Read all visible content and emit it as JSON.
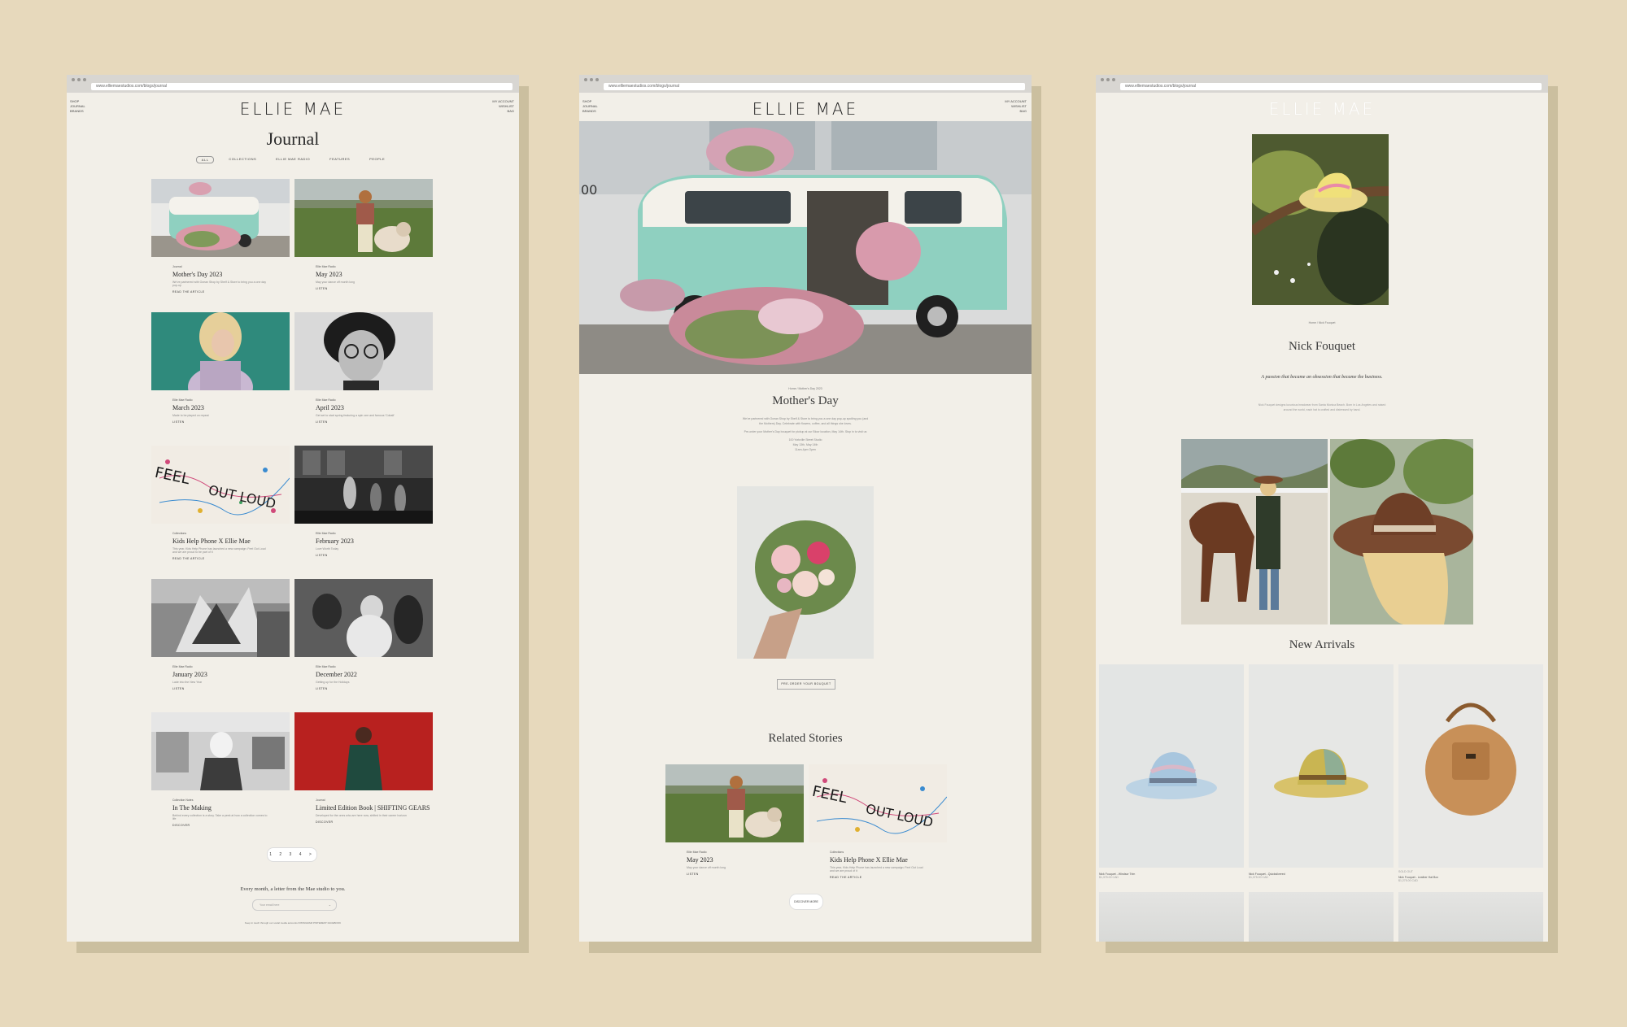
{
  "brand": "ELLIE MAE",
  "url": "www.elliemaestudios.com/blogs/journal",
  "nav_left": [
    "SHOP",
    "JOURNAL",
    "BRANDS"
  ],
  "nav_right": [
    "MY ACCOUNT",
    "WISHLIST",
    "BAG"
  ],
  "journal": {
    "title": "Journal",
    "filters": [
      "ALL",
      "COLLECTIONS",
      "ELLIE MAE RADIO",
      "FEATURES",
      "PEOPLE"
    ],
    "cards": [
      {
        "category": "Journal",
        "title": "Mother's Day 2023",
        "excerpt": "We've partnered with Ocean Shop by Shelf & Store to bring you a one day pop-up",
        "link": "READ THE ARTICLE"
      },
      {
        "category": "Ellie Mae Radio",
        "title": "May 2023",
        "excerpt": "May your dance off month long",
        "link": "LISTEN"
      },
      {
        "category": "Ellie Mae Radio",
        "title": "March 2023",
        "excerpt": "Made to be played on repeat",
        "link": "LISTEN"
      },
      {
        "category": "Ellie Mae Radio",
        "title": "April 2023",
        "excerpt": "Get set to start spring featuring a spin one and famous 'Cobalt'",
        "link": "LISTEN"
      },
      {
        "category": "Collections",
        "title": "Kids Help Phone X Ellie Mae",
        "excerpt": "This year, Kids Help Phone has launched a new campaign: Feel Out Loud and we are proud to be part of it",
        "link": "READ THE ARTICLE"
      },
      {
        "category": "Ellie Mae Radio",
        "title": "February 2023",
        "excerpt": "Love Worth Today",
        "link": "LISTEN"
      },
      {
        "category": "Ellie Mae Radio",
        "title": "January 2023",
        "excerpt": "Lade into the New Year",
        "link": "LISTEN"
      },
      {
        "category": "Ellie Mae Radio",
        "title": "December 2022",
        "excerpt": "Getting up for the Holidays",
        "link": "LISTEN"
      },
      {
        "category": "Collection Notes",
        "title": "In The Making",
        "excerpt": "Behind every collection is a story. Take a peek at how a collection comes to life",
        "link": "DISCOVER"
      },
      {
        "category": "Journal",
        "title": "Limited Edition Book | SHIFTING GEARS",
        "excerpt": "Developed for the ones who are here now, shifted in their career horizon",
        "link": "DISCOVER"
      }
    ],
    "pagination": "1 2 3 4 >",
    "newsletter": {
      "title": "Every month, a letter from the Mae studio to you.",
      "placeholder": "Your email here",
      "submit": "→",
      "footer": "Keep in touch through our social media accounts   INSTAGRAM   PINTEREST   FACEBOOK"
    }
  },
  "article": {
    "breadcrumb": "Home / Mother's Day 2023",
    "title": "Mother's Day",
    "paragraphs": [
      "We've partnered with Ocean Shop by Shelf & Store to bring you a one day pop-up spoiling you (and the Mothers) Day. Celebrate with flowers, coffee, and all things she loves.",
      "Pre-order your Mother's Day bouquet for pickup at our Bloor location, May 14th. Stop in to visit us",
      "100 Yorkville Street Studio",
      "May 13th, May 14th",
      "11am-4pm Open"
    ],
    "button": "PRE-ORDER YOUR BOUQUET",
    "related_title": "Related Stories",
    "related": [
      {
        "category": "Ellie Mae Radio",
        "title": "May 2023",
        "excerpt": "May your dance off month long",
        "link": "LISTEN"
      },
      {
        "category": "Collections",
        "title": "Kids Help Phone X Ellie Mae",
        "excerpt": "This year, Kids Help Phone has launched a new campaign: Feel Out Loud and we are proud of it",
        "link": "READ THE ARTICLE"
      }
    ],
    "more_button": "DISCOVER MORE"
  },
  "brand_page": {
    "breadcrumb": "Home / Nick Fouquet",
    "title": "Nick Fouquet",
    "tagline": "A passion that became an obsession that became the business.",
    "body": "Nick Fouquet designs luxurious headwear from Santa Monica Beach. Born in Los Angeles and raised around the world, each hat is crafted and distressed by hand.",
    "new_arrivals": "New Arrivals",
    "products": [
      {
        "label": "Nick Fouquet - Windsor Trim",
        "price": "$1,375.00 CAD"
      },
      {
        "label": "Nick Fouquet - Quicksilvered",
        "price": "$1,375.00 CAD"
      },
      {
        "label": "Nick Fouquet - Leather Hat Box",
        "price": "$1,275.00 CAD",
        "tag": "SOLD OUT"
      }
    ]
  },
  "colors": {
    "background": "#e7d9bc",
    "page": "#f2efe8",
    "shadow": "#cbbf9f",
    "text": "#2a2a2a",
    "accent_red": "#b8211f",
    "bus_mint": "#8fd0c0"
  }
}
